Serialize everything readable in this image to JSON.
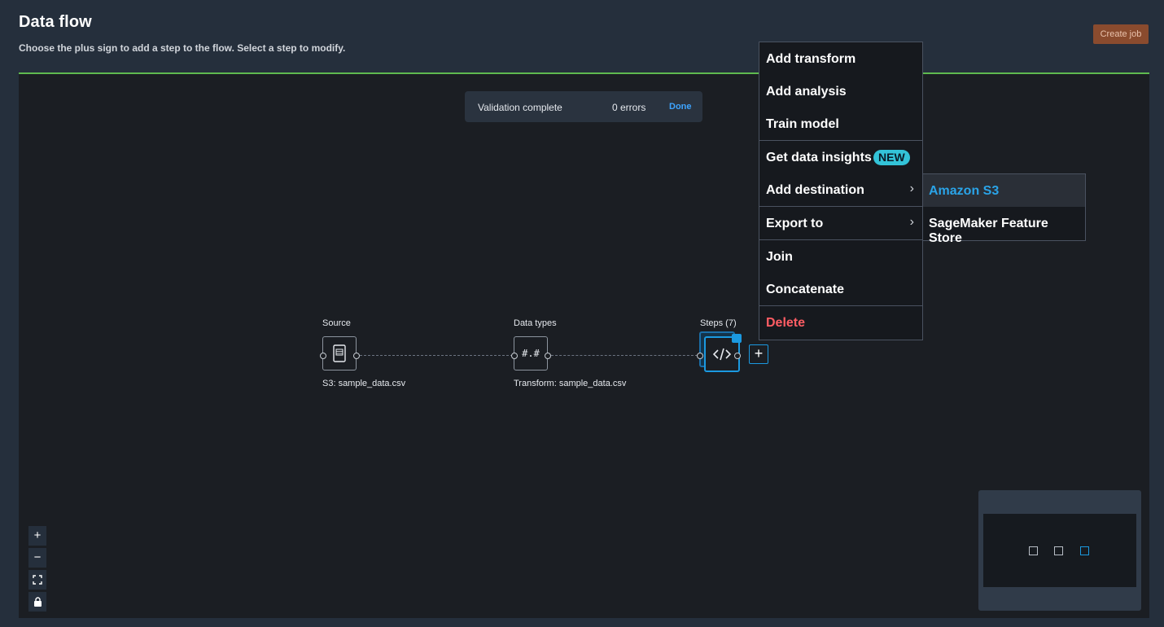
{
  "header": {
    "title": "Data flow",
    "subtitle": "Choose the plus sign to add a step to the flow. Select a step to modify.",
    "create_job_label": "Create job"
  },
  "validation": {
    "status": "Validation complete",
    "errors": "0 errors",
    "done_label": "Done"
  },
  "nodes": [
    {
      "title": "Source",
      "caption": "S3: sample_data.csv",
      "icon": "file-icon"
    },
    {
      "title": "Data types",
      "caption": "Transform: sample_data.csv",
      "icon": "hash-icon",
      "glyph": "#.#"
    },
    {
      "title": "Steps (7)",
      "caption": "",
      "icon": "code-icon"
    }
  ],
  "add_step_label": "+",
  "menu": {
    "items": [
      {
        "label": "Add transform"
      },
      {
        "label": "Add analysis"
      },
      {
        "label": "Train model"
      },
      {
        "label": "Get data insights",
        "badge": "NEW"
      },
      {
        "label": "Add destination",
        "has_submenu": true
      },
      {
        "label": "Export to",
        "has_submenu": true
      },
      {
        "label": "Join"
      },
      {
        "label": "Concatenate"
      },
      {
        "label": "Delete"
      }
    ]
  },
  "submenu": {
    "items": [
      {
        "label": "Amazon S3"
      },
      {
        "label": "SageMaker Feature Store"
      }
    ]
  },
  "zoom_controls": {
    "zoom_in": "+",
    "zoom_out": "−"
  },
  "colors": {
    "background": "#252f3c",
    "canvas": "#1b1e23",
    "accent_green": "#5fba4f",
    "primary_blue": "#1b99e0",
    "link_blue": "#3da4ff",
    "delete_red": "#ff5d64",
    "new_badge": "#33c3d8",
    "create_job": "#8a4b2e"
  }
}
